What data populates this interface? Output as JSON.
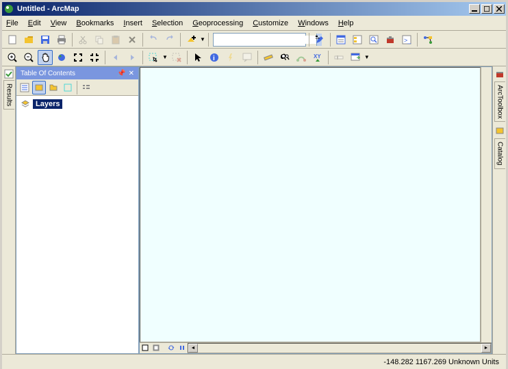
{
  "title": "Untitled - ArcMap",
  "menus": [
    "File",
    "Edit",
    "View",
    "Bookmarks",
    "Insert",
    "Selection",
    "Geoprocessing",
    "Customize",
    "Windows",
    "Help"
  ],
  "toc": {
    "title": "Table Of Contents",
    "root": "Layers"
  },
  "left_tab": "Results",
  "right_tabs": [
    "ArcToolbox",
    "Catalog"
  ],
  "statusbar": {
    "x": "-148.282",
    "y": "1167.269",
    "units": "Unknown Units"
  },
  "toolbar1": {
    "new": "New",
    "open": "Open",
    "save": "Save",
    "print": "Print",
    "cut": "Cut",
    "copy": "Copy",
    "paste": "Paste",
    "delete": "Delete",
    "undo": "Undo",
    "redo": "Redo",
    "addData": "Add Data",
    "scale": "",
    "editor": "Editor Toolbar",
    "toc": "Table Of Contents",
    "catalog": "Catalog",
    "search": "Search",
    "toolbox": "ArcToolbox",
    "python": "Python",
    "modelBuilder": "ModelBuilder"
  },
  "toolbar2": {
    "zoomIn": "Zoom In",
    "zoomOut": "Zoom Out",
    "pan": "Pan",
    "fullExtent": "Full Extent",
    "fixedZoomIn": "Fixed Zoom In",
    "fixedZoomOut": "Fixed Zoom Out",
    "prevExtent": "Go Back",
    "nextExtent": "Go Forward",
    "select": "Select Features",
    "clearSel": "Clear Selected",
    "pointer": "Select Elements",
    "identify": "Identify",
    "hyperlink": "Hyperlink",
    "htmlPopup": "HTML Popup",
    "measure": "Measure",
    "find": "Find",
    "findRoute": "Find Route",
    "goToXY": "Go To XY",
    "timeSlider": "Time Slider",
    "viewer": "Create Viewer"
  },
  "map_tabs": {
    "data": "Data View",
    "layout": "Layout View",
    "refresh": "Refresh",
    "pause": "Pause"
  }
}
